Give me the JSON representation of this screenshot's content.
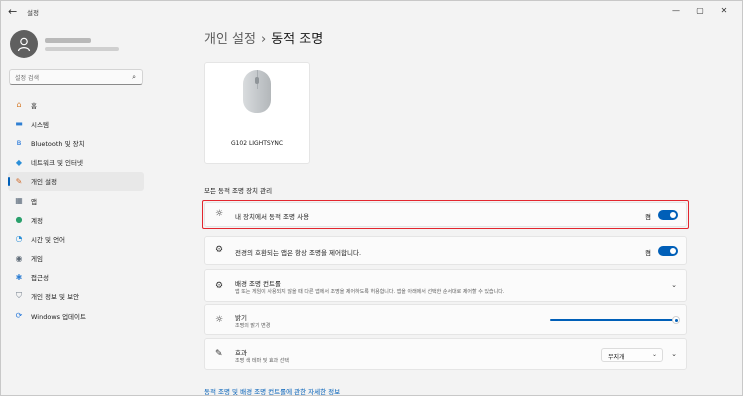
{
  "window": {
    "title": "설정",
    "back_glyph": "←",
    "min_glyph": "—",
    "max_glyph": "▢",
    "close_glyph": "✕"
  },
  "search": {
    "placeholder": "설정 검색"
  },
  "sidebar": {
    "items": [
      {
        "label": "홈",
        "icon": "home-icon",
        "glyph": "⌂",
        "color": "#d57b2c"
      },
      {
        "label": "시스템",
        "icon": "system-icon",
        "glyph": "▬",
        "color": "#2f7fd3"
      },
      {
        "label": "Bluetooth 및 장치",
        "icon": "bluetooth-icon",
        "glyph": "ʙ",
        "color": "#1e73d9"
      },
      {
        "label": "네트워크 및 인터넷",
        "icon": "network-icon",
        "glyph": "◆",
        "color": "#2b8fd8"
      },
      {
        "label": "개인 설정",
        "icon": "personalization-icon",
        "glyph": "✎",
        "color": "#d06a2a",
        "active": true
      },
      {
        "label": "앱",
        "icon": "apps-icon",
        "glyph": "▦",
        "color": "#5b6a7a"
      },
      {
        "label": "계정",
        "icon": "accounts-icon",
        "glyph": "●",
        "color": "#2aa06c"
      },
      {
        "label": "시간 및 언어",
        "icon": "time-language-icon",
        "glyph": "◔",
        "color": "#2b8fd8"
      },
      {
        "label": "게임",
        "icon": "gaming-icon",
        "glyph": "◉",
        "color": "#5f6b77"
      },
      {
        "label": "접근성",
        "icon": "accessibility-icon",
        "glyph": "✱",
        "color": "#2f7fd3"
      },
      {
        "label": "개인 정보 및 보안",
        "icon": "privacy-shield-icon",
        "glyph": "⛉",
        "color": "#6b7785"
      },
      {
        "label": "Windows 업데이트",
        "icon": "windows-update-icon",
        "glyph": "⟳",
        "color": "#1e73d9"
      }
    ]
  },
  "breadcrumb": {
    "parent": "개인 설정",
    "separator": "›",
    "current": "동적 조명"
  },
  "device": {
    "name": "G102 LIGHTSYNC"
  },
  "section_title": "모든 동적 조명 장치 관리",
  "rows": {
    "use_dynamic": {
      "label": "내 장치에서 동적 조명 사용",
      "state": "켬",
      "icon": "sun-icon",
      "glyph": "☼",
      "on": true
    },
    "compatible": {
      "label": "전경의 호환되는 앱은 항상 조명을 제어합니다.",
      "state": "켬",
      "icon": "apps-control-icon",
      "glyph": "⚙",
      "on": true
    },
    "background": {
      "label": "배경 조명 컨트롤",
      "desc": "앱 또는 게임이 사용되지 않을 때 다른 앱에서 조명을 제어하도록 허용합니다. 앱을 아래에서 선택한 순서대로 제어할 수 있습니다.",
      "icon": "gear-icon",
      "glyph": "⚙",
      "chevron": "⌄"
    },
    "brightness": {
      "label": "밝기",
      "desc": "조명의 밝기 변경",
      "icon": "brightness-icon",
      "glyph": "☼",
      "value": 1.0
    },
    "effects": {
      "label": "효과",
      "desc": "조명 색 테마 및 효과 선택",
      "icon": "brush-icon",
      "glyph": "✎",
      "selected": "무지개",
      "select_chevron": "⌄",
      "chevron": "⌄"
    }
  },
  "link": "동적 조명 및 배경 조명 컨트롤에 관한 자세한 정보",
  "colors": {
    "accent": "#005fb8",
    "highlight": "#e3262e"
  }
}
